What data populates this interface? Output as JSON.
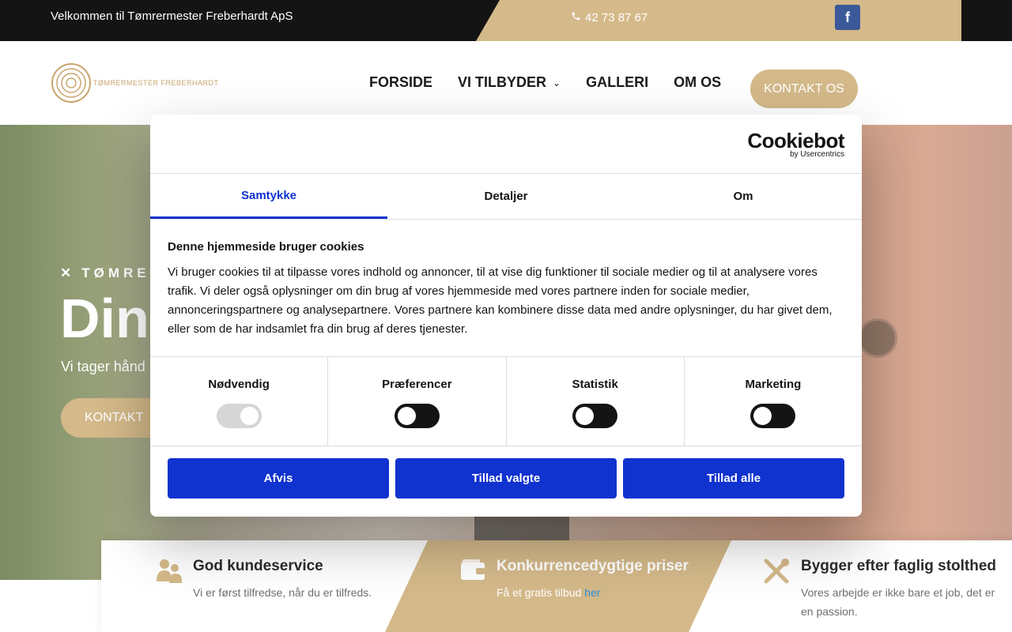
{
  "topbar": {
    "welcome": "Velkommen til Tømrermester Freberhardt ApS",
    "phone": "42 73 87 67",
    "facebook_icon": "f"
  },
  "header": {
    "logo_text": "TØMRERMESTER FREBERHARDT",
    "nav": [
      {
        "label": "FORSIDE"
      },
      {
        "label": "VI TILBYDER",
        "has_dropdown": true
      },
      {
        "label": "GALLERI"
      },
      {
        "label": "OM OS"
      }
    ],
    "contact_button": "KONTAKT OS"
  },
  "hero": {
    "subtitle": "TØMRERM",
    "title": "Din",
    "tagline": "Vi tager hånd",
    "button": "KONTAKT"
  },
  "features": [
    {
      "icon": "users-icon",
      "title": "God kundeservice",
      "text": "Vi er først tilfredse, når du er tilfreds."
    },
    {
      "icon": "wallet-icon",
      "title": "Konkurrencedygtige priser",
      "text": "Få et gratis tilbud ",
      "link": "her"
    },
    {
      "icon": "tools-icon",
      "title": "Bygger efter faglig stolthed",
      "text": "Vores arbejde er ikke bare et job, det er en passion."
    }
  ],
  "cookie_dialog": {
    "brand": "Cookiebot",
    "brand_sub": "by Usercentrics",
    "tabs": [
      "Samtykke",
      "Detaljer",
      "Om"
    ],
    "active_tab": "Samtykke",
    "title": "Denne hjemmeside bruger cookies",
    "text": "Vi bruger cookies til at tilpasse vores indhold og annoncer, til at vise dig funktioner til sociale medier og til at analysere vores trafik. Vi deler også oplysninger om din brug af vores hjemmeside med vores partnere inden for sociale medier, annonceringspartnere og analysepartnere. Vores partnere kan kombinere disse data med andre oplysninger, du har givet dem, eller som de har indsamlet fra din brug af deres tjenester.",
    "toggles": [
      {
        "label": "Nødvendig",
        "state": "on-disabled"
      },
      {
        "label": "Præferencer",
        "state": "off"
      },
      {
        "label": "Statistik",
        "state": "off"
      },
      {
        "label": "Marketing",
        "state": "off"
      }
    ],
    "buttons": [
      "Afvis",
      "Tillad valgte",
      "Tillad alle"
    ]
  },
  "colors": {
    "gold": "#d4b98a",
    "cookie_blue": "#1032cf",
    "topbar_dark": "#141414"
  }
}
